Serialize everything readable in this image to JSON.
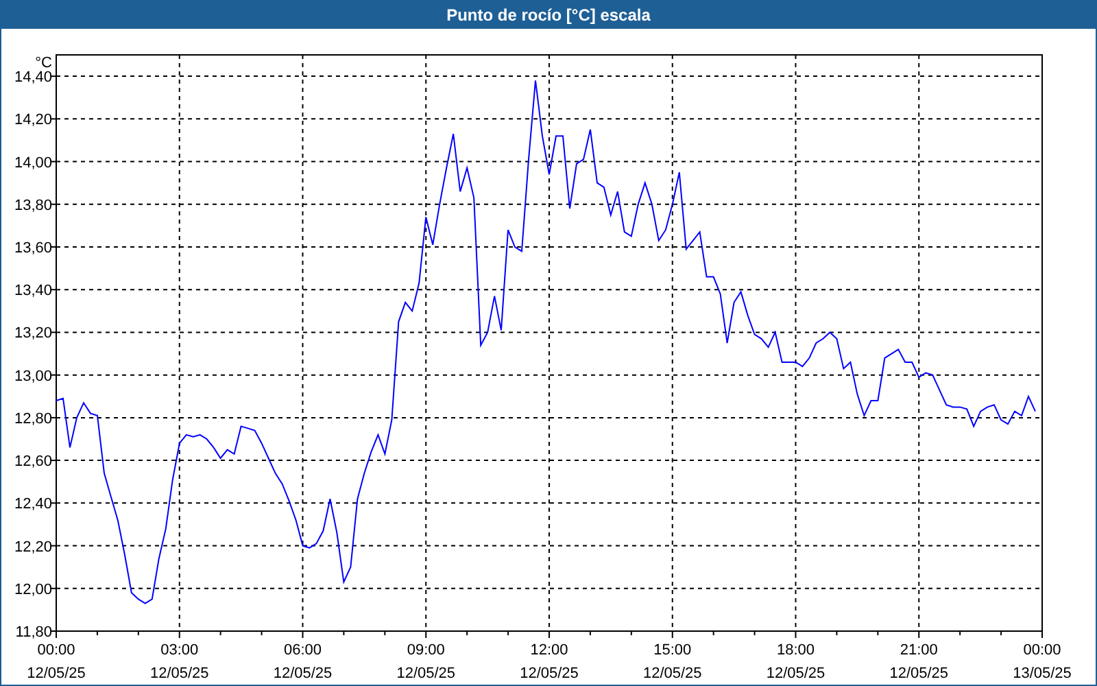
{
  "window": {
    "title": "Punto de rocío [°C] escala"
  },
  "chart": {
    "chart_data": {
      "type": "line",
      "grid": true,
      "ylabel": "°C",
      "ylim": [
        11.8,
        14.5
      ],
      "yticks": [
        {
          "value": 11.8,
          "label": "11,80"
        },
        {
          "value": 12,
          "label": "12,00"
        },
        {
          "value": 12.2,
          "label": "12,20"
        },
        {
          "value": 12.4,
          "label": "12,40"
        },
        {
          "value": 12.6,
          "label": "12,60"
        },
        {
          "value": 12.8,
          "label": "12,80"
        },
        {
          "value": 13,
          "label": "13,00"
        },
        {
          "value": 13.2,
          "label": "13,20"
        },
        {
          "value": 13.4,
          "label": "13,40"
        },
        {
          "value": 13.6,
          "label": "13,60"
        },
        {
          "value": 13.8,
          "label": "13,80"
        },
        {
          "value": 14,
          "label": "14,00"
        },
        {
          "value": 14.2,
          "label": "14,20"
        },
        {
          "value": 14.4,
          "label": "14,40"
        }
      ],
      "categories": [
        "00:00\n12/05/25",
        null,
        null,
        null,
        null,
        null,
        null,
        null,
        null,
        null,
        null,
        null,
        null,
        null,
        null,
        null,
        null,
        null,
        "03:00\n12/05/25",
        null,
        null,
        null,
        null,
        null,
        null,
        null,
        null,
        null,
        null,
        null,
        null,
        null,
        null,
        null,
        null,
        null,
        "06:00\n12/05/25",
        null,
        null,
        null,
        null,
        null,
        null,
        null,
        null,
        null,
        null,
        null,
        null,
        null,
        null,
        null,
        null,
        null,
        "09:00\n12/05/25",
        null,
        null,
        null,
        null,
        null,
        null,
        null,
        null,
        null,
        null,
        null,
        null,
        null,
        null,
        null,
        null,
        null,
        "12:00\n12/05/25",
        null,
        null,
        null,
        null,
        null,
        null,
        null,
        null,
        null,
        null,
        null,
        null,
        null,
        null,
        null,
        null,
        null,
        "15:00\n12/05/25",
        null,
        null,
        null,
        null,
        null,
        null,
        null,
        null,
        null,
        null,
        null,
        null,
        null,
        null,
        null,
        null,
        null,
        "18:00\n12/05/25",
        null,
        null,
        null,
        null,
        null,
        null,
        null,
        null,
        null,
        null,
        null,
        null,
        null,
        null,
        null,
        null,
        null,
        "21:00\n12/05/25",
        null,
        null,
        null,
        null,
        null,
        null,
        null,
        null,
        null,
        null,
        null,
        null,
        null,
        null,
        null,
        null,
        null,
        "00:00\n13/05/25"
      ],
      "series": [
        {
          "color": "#0000ff",
          "values": [
            12.88,
            12.89,
            12.66,
            12.8,
            12.87,
            12.82,
            12.81,
            12.54,
            12.43,
            12.32,
            12.16,
            11.98,
            11.95,
            11.93,
            11.95,
            12.14,
            12.28,
            12.51,
            12.68,
            12.72,
            12.71,
            12.72,
            12.7,
            12.66,
            12.61,
            12.65,
            12.63,
            12.76,
            12.75,
            12.74,
            12.68,
            12.61,
            12.54,
            12.49,
            12.41,
            12.32,
            12.2,
            12.19,
            12.21,
            12.27,
            12.42,
            12.26,
            12.03,
            12.1,
            12.42,
            12.54,
            12.64,
            12.72,
            12.63,
            12.79,
            13.25,
            13.34,
            13.3,
            13.43,
            13.74,
            13.61,
            13.8,
            13.97,
            14.13,
            13.86,
            13.97,
            13.83,
            13.14,
            13.2,
            13.37,
            13.21,
            13.68,
            13.6,
            13.58,
            14.01,
            14.38,
            14.12,
            13.94,
            14.12,
            14.12,
            13.78,
            13.99,
            14.01,
            14.15,
            13.9,
            13.88,
            13.75,
            13.86,
            13.67,
            13.65,
            13.8,
            13.9,
            13.8,
            13.63,
            13.68,
            13.8,
            13.95,
            13.59,
            13.63,
            13.67,
            13.46,
            13.46,
            13.38,
            13.15,
            13.34,
            13.39,
            13.28,
            13.19,
            13.17,
            13.13,
            13.2,
            13.06,
            13.06,
            13.06,
            13.04,
            13.08,
            13.15,
            13.17,
            13.2,
            13.17,
            13.03,
            13.06,
            12.91,
            12.81,
            12.88,
            12.88,
            13.08,
            13.1,
            13.12,
            13.06,
            13.06,
            12.99,
            13.01,
            13,
            12.93,
            12.86,
            12.85,
            12.85,
            12.84,
            12.76,
            12.83,
            12.85,
            12.86,
            12.79,
            12.77,
            12.83,
            12.81,
            12.9,
            12.83,
            null
          ]
        }
      ]
    }
  }
}
